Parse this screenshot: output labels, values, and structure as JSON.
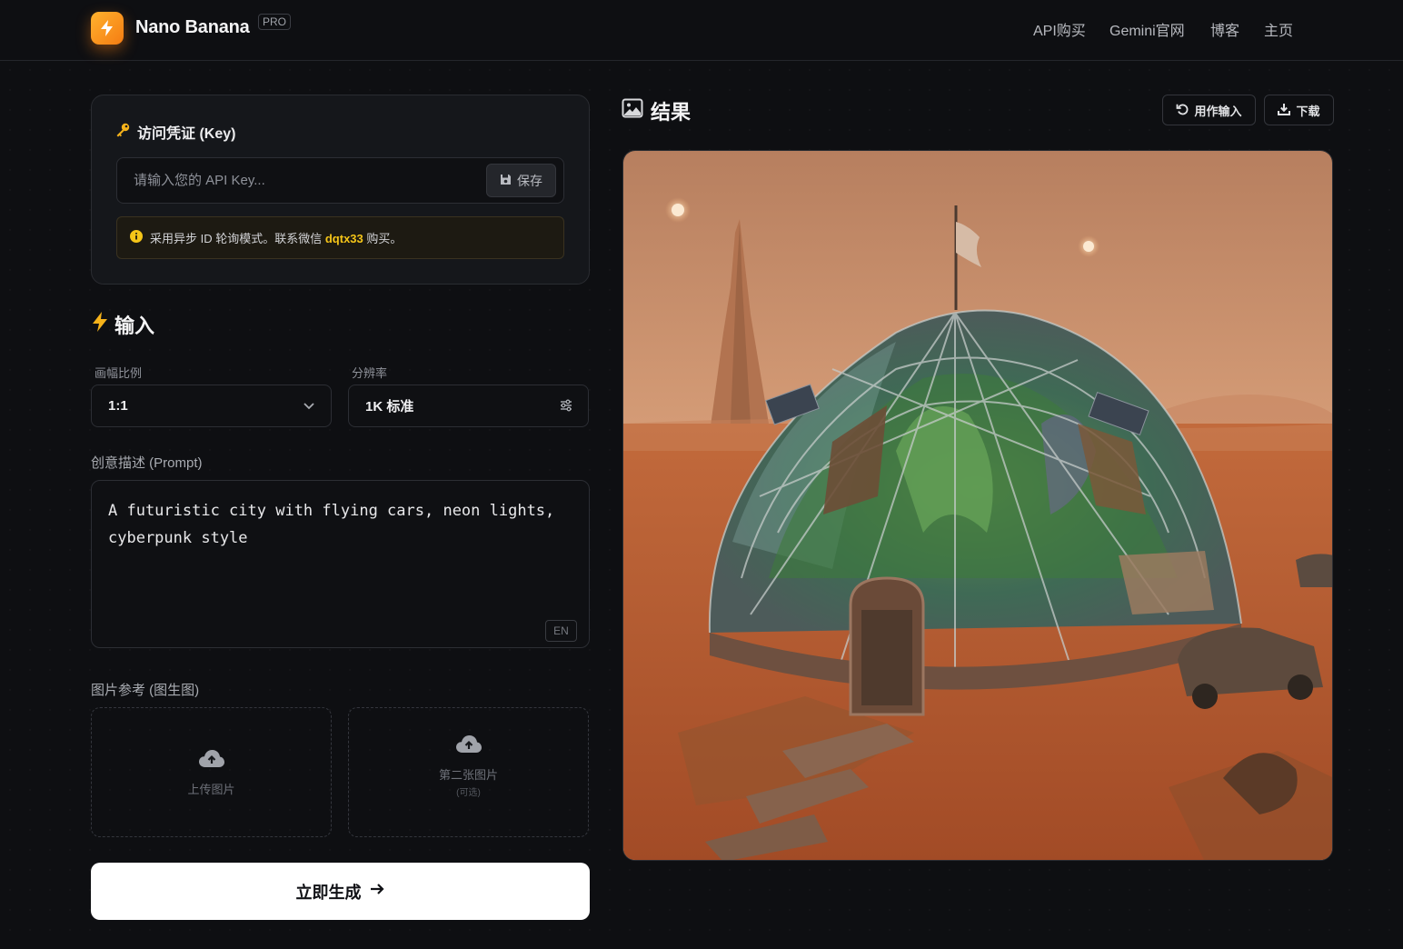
{
  "header": {
    "brand": "Nano Banana",
    "badge": "PRO",
    "nav": [
      "API购买",
      "Gemini官网",
      "博客",
      "主页"
    ]
  },
  "credentials": {
    "title": "访问凭证 (Key)",
    "placeholder": "请输入您的 API Key...",
    "save_label": "保存",
    "notice_prefix": "采用异步 ID 轮询模式。联系微信",
    "notice_wechat": "dqtx33",
    "notice_suffix": "购买。"
  },
  "input": {
    "title": "输入",
    "aspect_label": "画幅比例",
    "aspect_value": "1:1",
    "resolution_label": "分辨率",
    "resolution_value": "1K 标准",
    "prompt_label": "创意描述 (Prompt)",
    "prompt_value": "A futuristic city with flying cars, neon lights, cyberpunk style",
    "lang_badge": "EN",
    "ref_label": "图片参考 (图生图)",
    "upload1": "上传图片",
    "upload2": "第二张图片",
    "upload2_sub": "(可选)",
    "generate_label": "立即生成"
  },
  "result": {
    "title": "结果",
    "use_as_input": "用作输入",
    "download": "下载"
  },
  "colors": {
    "accent": "#f59e0b",
    "wechat": "#f5c518",
    "background": "#0e0f12"
  }
}
